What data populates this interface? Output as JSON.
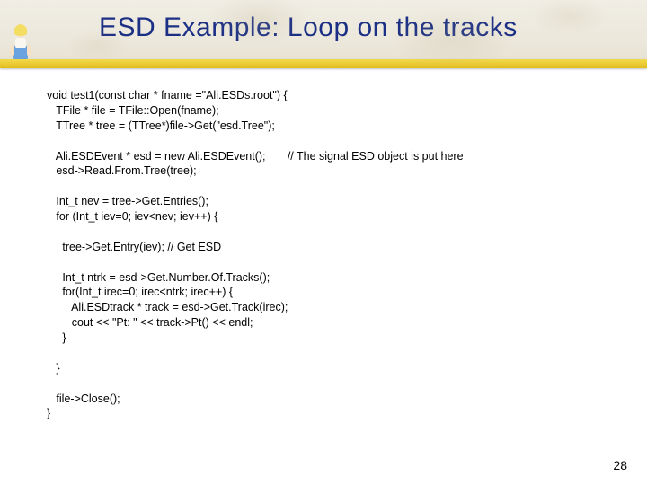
{
  "slide": {
    "title": "ESD Example: Loop on the tracks",
    "page_number": "28"
  },
  "code": {
    "l01": "void test1(const char * fname =\"Ali.ESDs.root\") {",
    "l02": "   TFile * file = TFile::Open(fname);",
    "l03": "   TTree * tree = (TTree*)file->Get(\"esd.Tree\");",
    "l04": "",
    "l05": "   Ali.ESDEvent * esd = new Ali.ESDEvent();       // The signal ESD object is put here",
    "l06": "   esd->Read.From.Tree(tree);",
    "l07": "",
    "l08": "   Int_t nev = tree->Get.Entries();",
    "l09": "   for (Int_t iev=0; iev<nev; iev++) {",
    "l10": "",
    "l11": "     tree->Get.Entry(iev); // Get ESD",
    "l12": "",
    "l13": "     Int_t ntrk = esd->Get.Number.Of.Tracks();",
    "l14": "     for(Int_t irec=0; irec<ntrk; irec++) {",
    "l15": "        Ali.ESDtrack * track = esd->Get.Track(irec);",
    "l16": "        cout << \"Pt: \" << track->Pt() << endl;",
    "l17": "     }",
    "l18": "",
    "l19": "   }",
    "l20": "",
    "l21": "   file->Close();",
    "l22": "}"
  }
}
